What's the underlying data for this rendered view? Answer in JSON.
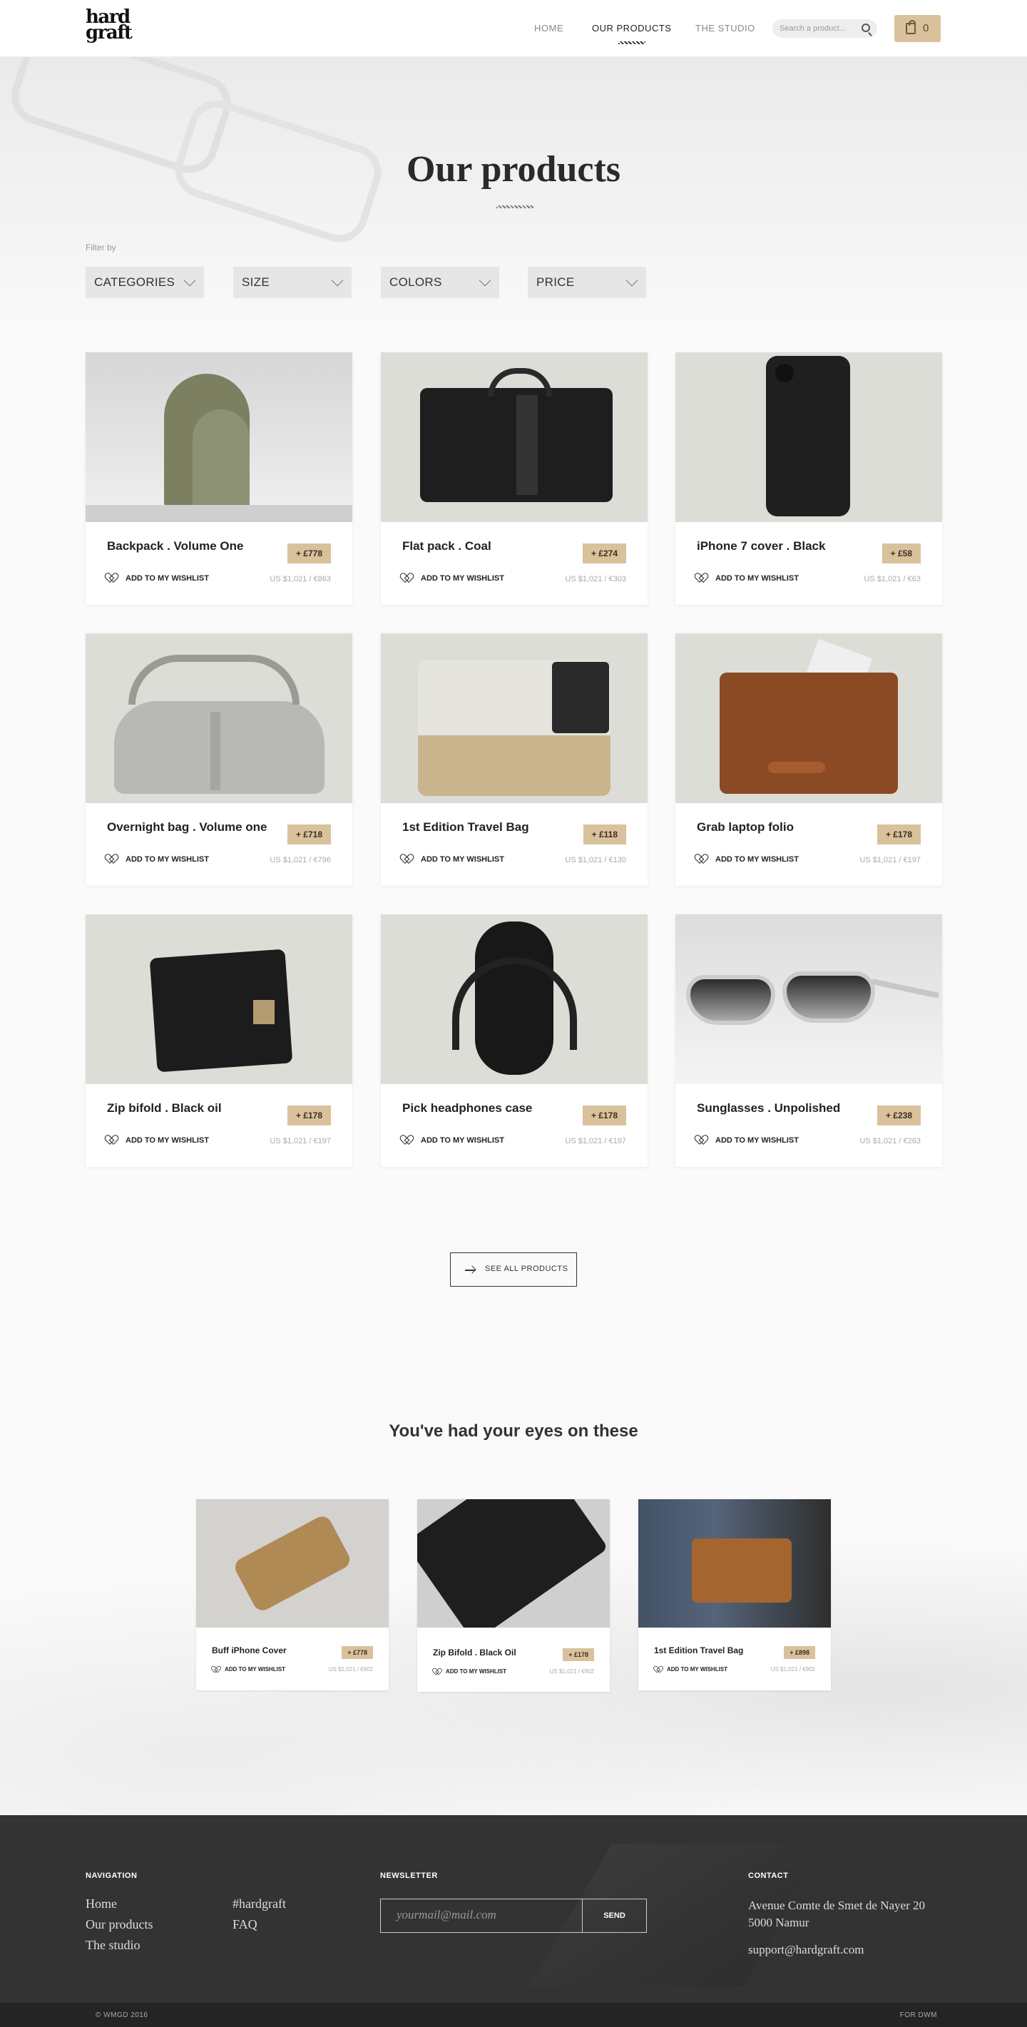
{
  "header": {
    "logo_line1": "hard",
    "logo_line2": "graft",
    "nav": [
      "HOME",
      "OUR PRODUCTS",
      "THE STUDIO"
    ],
    "search_placeholder": "Search a product...",
    "cart_count": "0"
  },
  "hero": {
    "title": "Our products",
    "filter_label": "Filter by",
    "filters": [
      "CATEGORIES",
      "SIZE",
      "COLORS",
      "PRICE"
    ]
  },
  "products": [
    {
      "name": "Backpack . Volume One",
      "price": "+ £778",
      "wishlist": "ADD TO MY WISHLIST",
      "conv": "US $1,021 / €863"
    },
    {
      "name": "Flat pack . Coal",
      "price": "+ £274",
      "wishlist": "ADD TO MY WISHLIST",
      "conv": "US $1,021 / €303"
    },
    {
      "name": "iPhone 7 cover . Black",
      "price": "+ £58",
      "wishlist": "ADD TO MY WISHLIST",
      "conv": "US $1,021 / €63"
    },
    {
      "name": "Overnight bag . Volume one",
      "price": "+ £718",
      "wishlist": "ADD TO MY WISHLIST",
      "conv": "US $1,021 / €796"
    },
    {
      "name": "1st Edition Travel Bag",
      "price": "+ £118",
      "wishlist": "ADD TO MY WISHLIST",
      "conv": "US $1,021 / €130"
    },
    {
      "name": "Grab laptop folio",
      "price": "+ £178",
      "wishlist": "ADD TO MY WISHLIST",
      "conv": "US $1,021 / €197"
    },
    {
      "name": "Zip bifold . Black oil",
      "price": "+ £178",
      "wishlist": "ADD TO MY WISHLIST",
      "conv": "US $1,021 / €197"
    },
    {
      "name": "Pick headphones case",
      "price": "+ £178",
      "wishlist": "ADD TO MY WISHLIST",
      "conv": "US $1,021 / €197"
    },
    {
      "name": "Sunglasses . Unpolished",
      "price": "+ £238",
      "wishlist": "ADD TO MY WISHLIST",
      "conv": "US $1,021 / €263"
    }
  ],
  "see_all": "SEE ALL PRODUCTS",
  "eyes": {
    "title": "You've had your eyes on these",
    "items": [
      {
        "name": "Buff iPhone Cover",
        "price": "+ £778",
        "wishlist": "ADD TO MY WISHLIST",
        "conv": "US $1,021 / €902"
      },
      {
        "name": "Zip Bifold . Black Oil",
        "price": "+ £178",
        "wishlist": "ADD TO MY WISHLIST",
        "conv": "US $1,021 / €902"
      },
      {
        "name": "1st Edition Travel Bag",
        "price": "+ £898",
        "wishlist": "ADD TO MY WISHLIST",
        "conv": "US $1,021 / €902"
      }
    ]
  },
  "footer": {
    "nav_heading": "NAVIGATION",
    "nav_links": [
      "Home",
      "Our products",
      "The studio"
    ],
    "nav_links2": [
      "#hardgraft",
      "FAQ"
    ],
    "newsletter_heading": "NEWSLETTER",
    "newsletter_placeholder": "yourmail@mail.com",
    "send": "SEND",
    "contact_heading": "CONTACT",
    "address_line1": "Avenue Comte de Smet de Nayer 20",
    "address_line2": "5000 Namur",
    "email": "support@hardgraft.com",
    "copyright": "© WMGD 2016",
    "credit": "FOR DWM"
  },
  "colors": {
    "accent": "#d9c19c",
    "footer": "#333333",
    "text": "#222222"
  }
}
